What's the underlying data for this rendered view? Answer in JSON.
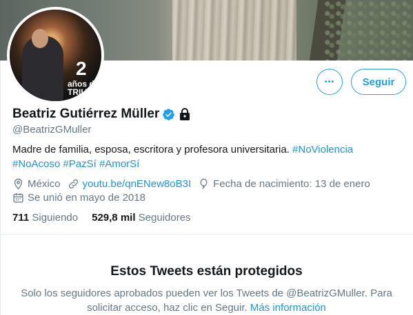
{
  "profile": {
    "name": "Beatriz Gutiérrez Müller",
    "handle": "@BeatrizGMuller",
    "bio_text": "Madre de familia, esposa, escritora y profesora universitaria. ",
    "hashtags": [
      "#NoViolencia",
      "#NoAcoso",
      "#PazSí",
      "#AmorSí"
    ],
    "verified_icon": "verified-badge-icon",
    "protected_icon": "lock-icon",
    "avatar_number": "2",
    "avatar_caption_line1": "años de",
    "avatar_caption_line2": "TRIUNF"
  },
  "actions": {
    "more_label": "•••",
    "follow_label": "Seguir"
  },
  "meta": {
    "location": "México",
    "website": "youtu.be/qnENew8oB3I",
    "birthday": "Fecha de nacimiento: 13 de enero",
    "joined": "Se unió en mayo de 2018"
  },
  "stats": {
    "following_count": "711",
    "following_label": "Siguiendo",
    "followers_count": "529,8 mil",
    "followers_label": "Seguidores"
  },
  "protected": {
    "title": "Estos Tweets están protegidos",
    "text": "Solo los seguidores aprobados pueden ver los Tweets de @BeatrizGMuller. Para solicitar acceso, haz clic en Seguir. ",
    "more_info_link": "Más información"
  },
  "colors": {
    "accent": "#1da1f2",
    "link": "#1b95e0",
    "secondary_text": "#657786"
  }
}
